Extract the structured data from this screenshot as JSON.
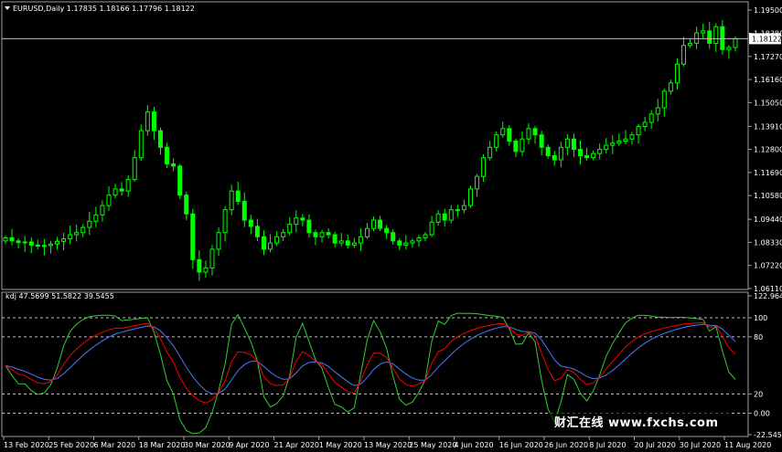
{
  "main_chart": {
    "title": "EURUSD,Daily  1.17835 1.18166 1.17796 1.18122",
    "y_ticks": [
      "1.19500",
      "1.18380",
      "1.17270",
      "1.16160",
      "1.15050",
      "1.13910",
      "1.12800",
      "1.11690",
      "1.10580",
      "1.09440",
      "1.08330",
      "1.07220",
      "1.06110"
    ],
    "current_price": "1.18122"
  },
  "indicator": {
    "title": "kdj 47.5699 51.5822 39.5455",
    "y_ticks": [
      "122.9643",
      "100",
      "80",
      "20",
      "0.00",
      "-22.5455"
    ]
  },
  "x_axis": {
    "labels": [
      "13 Feb 2020",
      "25 Feb 2020",
      "6 Mar 2020",
      "18 Mar 2020",
      "30 Mar 2020",
      "9 Apr 2020",
      "21 Apr 2020",
      "1 May 2020",
      "13 May 2020",
      "25 May 2020",
      "4 Jun 2020",
      "16 Jun 2020",
      "26 Jun 2020",
      "8 Jul 2020",
      "20 Jul 2020",
      "30 Jul 2020",
      "11 Aug 2020"
    ]
  },
  "watermark": "财汇在线 www.fxchs.com",
  "colors": {
    "candle": "#00ff00",
    "kdj_k": "#ff0000",
    "kdj_d": "#4b78ff",
    "kdj_j": "#32cd32",
    "grid": "#c0c0c0",
    "frame": "#a0a0a0"
  },
  "chart_data": [
    {
      "type": "candlestick",
      "title": "EURUSD,Daily",
      "ohlc_latest": {
        "open": 1.17835,
        "high": 1.18166,
        "low": 1.17796,
        "close": 1.18122
      },
      "ylim": [
        1.0611,
        1.195
      ],
      "close": [
        1.0855,
        1.084,
        1.0832,
        1.0835,
        1.082,
        1.0815,
        1.0818,
        1.0825,
        1.0838,
        1.085,
        1.087,
        1.088,
        1.0905,
        1.0935,
        1.0965,
        1.101,
        1.106,
        1.109,
        1.108,
        1.1135,
        1.124,
        1.137,
        1.146,
        1.137,
        1.129,
        1.121,
        1.12,
        1.106,
        1.097,
        1.075,
        1.069,
        1.071,
        1.08,
        1.088,
        1.099,
        1.108,
        1.103,
        1.094,
        1.091,
        1.086,
        1.08,
        1.083,
        1.086,
        1.088,
        1.092,
        1.095,
        1.094,
        1.088,
        1.086,
        1.088,
        1.087,
        1.083,
        1.084,
        1.082,
        1.083,
        1.086,
        1.09,
        1.094,
        1.09,
        1.088,
        1.084,
        1.082,
        1.083,
        1.084,
        1.0855,
        1.087,
        1.093,
        1.097,
        1.094,
        1.099,
        1.099,
        1.101,
        1.109,
        1.115,
        1.124,
        1.129,
        1.135,
        1.138,
        1.132,
        1.127,
        1.133,
        1.138,
        1.135,
        1.129,
        1.125,
        1.123,
        1.129,
        1.133,
        1.128,
        1.125,
        1.124,
        1.126,
        1.128,
        1.13,
        1.131,
        1.132,
        1.133,
        1.135,
        1.139,
        1.141,
        1.145,
        1.148,
        1.156,
        1.16,
        1.169,
        1.178,
        1.179,
        1.184,
        1.185,
        1.179,
        1.187,
        1.176,
        1.177,
        1.1812
      ]
    },
    {
      "type": "line",
      "title": "kdj",
      "values_latest": {
        "K": 47.5699,
        "D": 51.5822,
        "J": 39.5455
      },
      "ylim": [
        -22.5455,
        122.9643
      ],
      "levels": [
        100,
        80,
        20,
        0
      ]
    }
  ]
}
